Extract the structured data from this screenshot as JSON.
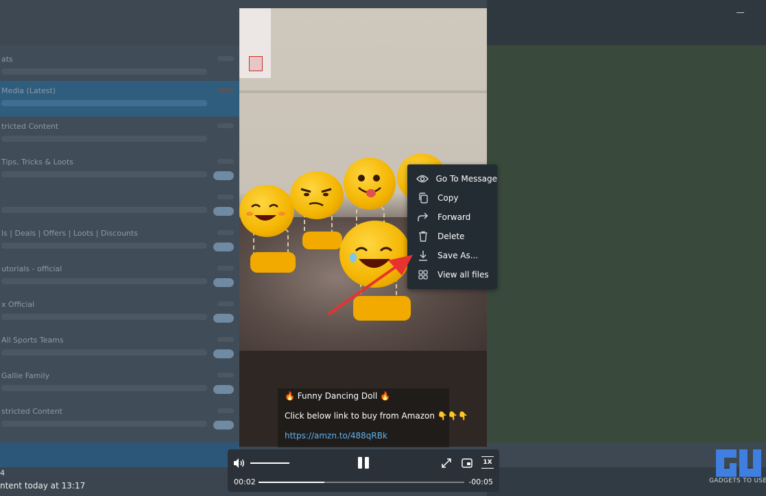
{
  "background_app": {
    "chats": [
      {
        "title": "ats",
        "active": false
      },
      {
        "title": "Media (Latest)",
        "active": true
      },
      {
        "title": "tricted Content",
        "active": false
      },
      {
        "title": "Tips, Tricks & Loots",
        "active": false
      },
      {
        "title": "",
        "active": false
      },
      {
        "title": "ls | Deals | Offers | Loots | Discounts",
        "active": false
      },
      {
        "title": "utorials - official",
        "active": false
      },
      {
        "title": "x Official",
        "active": false
      },
      {
        "title": "All Sports Teams",
        "active": false
      },
      {
        "title": "Gallie Family",
        "active": false
      },
      {
        "title": "stricted Content",
        "active": false
      }
    ],
    "status_count": "4",
    "status_text": "ntent   today at 13:17"
  },
  "caption": {
    "title": "🔥 Funny Dancing Doll 🔥",
    "body": "Click below link to buy from Amazon 👇👇👇",
    "link": "https://amzn.to/488qRBk"
  },
  "context_menu": {
    "items": [
      {
        "label": "Go To Message",
        "icon": "eye-icon"
      },
      {
        "label": "Copy",
        "icon": "copy-icon"
      },
      {
        "label": "Forward",
        "icon": "forward-icon"
      },
      {
        "label": "Delete",
        "icon": "trash-icon"
      },
      {
        "label": "Save As...",
        "icon": "download-icon"
      },
      {
        "label": "View all files",
        "icon": "grid-icon"
      }
    ]
  },
  "player": {
    "time_current": "00:02",
    "time_remaining": "-00:05",
    "progress": 0.32,
    "volume": 1.0,
    "speed_label": "1X"
  },
  "watermark": {
    "text": "GADGETS TO USE"
  },
  "colors": {
    "accent_link": "#5fb3f0",
    "annotation_arrow": "#e8322f",
    "menu_background": "#232b33"
  }
}
